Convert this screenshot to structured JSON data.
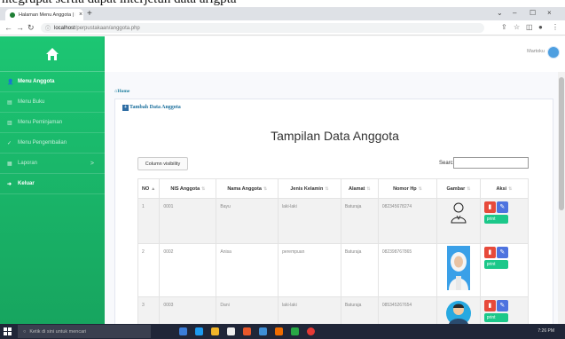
{
  "page_top_text": "ntegrupat sertia dapat interjetun data arigpta",
  "browser": {
    "tab_title": "Halaman Menu Anggota | MAN",
    "tab_close": "×",
    "new_tab": "+",
    "url_host": "localhost",
    "url_path": "/perpustakaan/anggota.php",
    "minimize": "⌄",
    "maximize": "–",
    "restore": "☐",
    "close": "×"
  },
  "sidebar": {
    "brand_icon": "home-icon",
    "items": [
      {
        "label": "Menu Anggota",
        "icon": "user-icon",
        "active": true
      },
      {
        "label": "Menu Buku",
        "icon": "book-icon"
      },
      {
        "label": "Menu Peminjaman",
        "icon": "book-open-icon"
      },
      {
        "label": "Menu Pengembalian",
        "icon": "check-icon"
      },
      {
        "label": "Laporan",
        "icon": "report-icon",
        "chevron": ">"
      },
      {
        "label": "Keluar",
        "icon": "logout-icon",
        "bold": true
      }
    ]
  },
  "topbar": {
    "user_name": "Martoku"
  },
  "breadcrumb": "Home",
  "add_link": "Tambah Data Anggota",
  "heading": "Tampilan Data Anggota",
  "column_visibility": "Column visibility",
  "search_label": "Search:",
  "search_value": "",
  "table": {
    "columns": [
      "NO",
      "NIS Anggota",
      "Nama Anggota",
      "Jenis Kelamin",
      "Alamat",
      "Nomor Hp",
      "Gambar",
      "Aksi"
    ],
    "rows": [
      {
        "no": "1",
        "nis": "0001",
        "nama": "Bayu",
        "jk": "laki-laki",
        "alamat": "Baturaja",
        "hp": "082345678274"
      },
      {
        "no": "2",
        "nis": "0002",
        "nama": "Anisa",
        "jk": "perempuan",
        "alamat": "Baturaja",
        "hp": "082398767865"
      },
      {
        "no": "3",
        "nis": "0003",
        "nama": "Dani",
        "jk": "laki-laki",
        "alamat": "Baturaja",
        "hp": "085345267654"
      }
    ],
    "print_label": "print"
  },
  "taskbar": {
    "search_placeholder": "Ketik di sini untuk mencari",
    "time": "7:26 PM"
  },
  "colors": {
    "sidebar": "#1cc673",
    "delete": "#e74a3b",
    "edit": "#4e73df",
    "print": "#1cc88a"
  }
}
